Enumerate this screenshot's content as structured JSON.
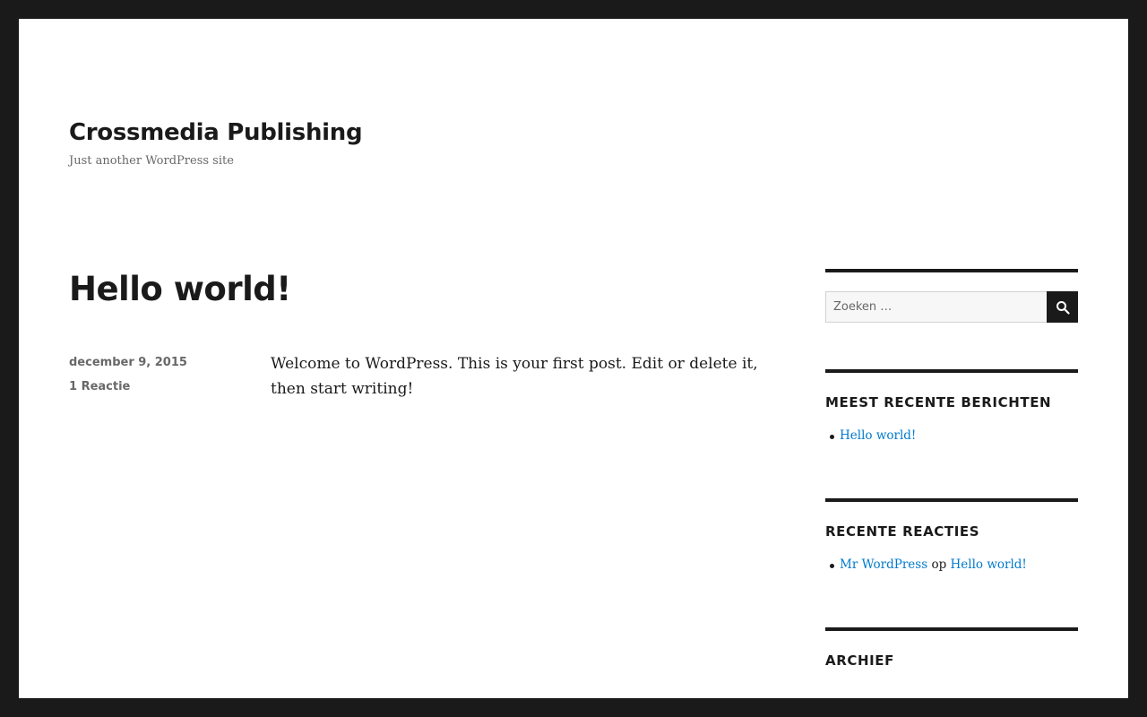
{
  "site": {
    "title": "Crossmedia Publishing",
    "description": "Just another WordPress site"
  },
  "post": {
    "title": "Hello world!",
    "date": "december 9, 2015",
    "comments": "1 Reactie",
    "content": "Welcome to WordPress. This is your first post. Edit or delete it, then start writing!"
  },
  "sidebar": {
    "search": {
      "placeholder": "Zoeken …",
      "icon": "search-icon"
    },
    "recent_posts": {
      "title": "MEEST RECENTE BERICHTEN",
      "items": [
        "Hello world!"
      ]
    },
    "recent_comments": {
      "title": "RECENTE REACTIES",
      "author": "Mr WordPress",
      "connector": "op",
      "post": "Hello world!"
    },
    "archive": {
      "title": "ARCHIEF"
    }
  },
  "colors": {
    "frame": "#1a1a1a",
    "link": "#007acc",
    "meta": "#686868"
  }
}
